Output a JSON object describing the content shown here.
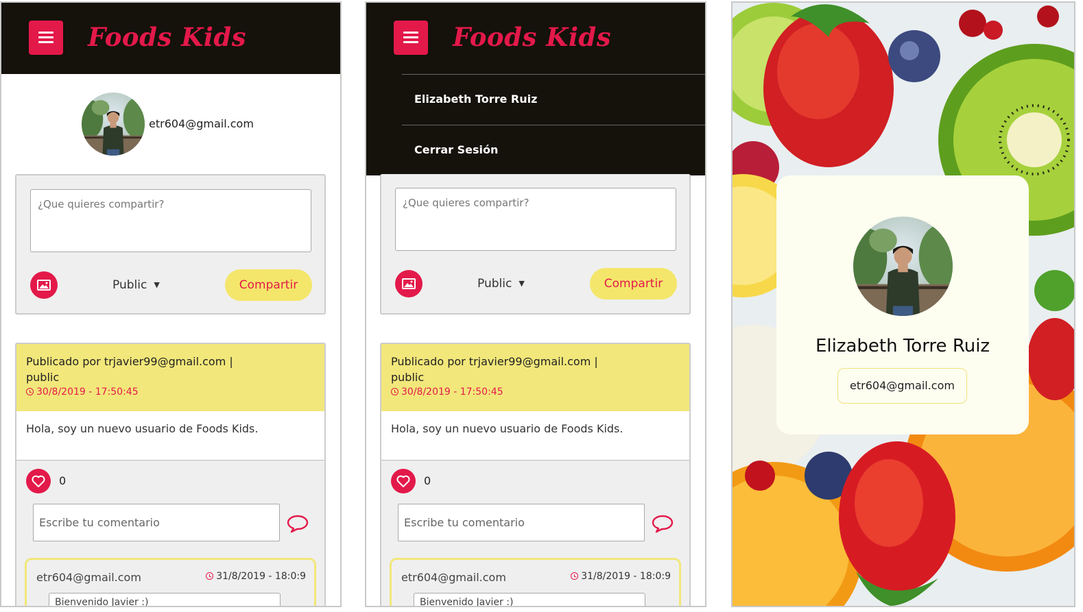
{
  "app": {
    "brand": "Foods Kids"
  },
  "user": {
    "email": "etr604@gmail.com",
    "name": "Elizabeth Torre Ruiz"
  },
  "menu": {
    "items": [
      {
        "label": "Elizabeth Torre Ruiz"
      },
      {
        "label": "Cerrar Sesión"
      }
    ]
  },
  "composer": {
    "placeholder": "¿Que quieres compartir?",
    "privacy": "Public",
    "share_label": "Compartir"
  },
  "post": {
    "author_line": "Publicado por trjavier99@gmail.com | public",
    "timestamp": "30/8/2019 - 17:50:45",
    "body": "Hola, soy un nuevo usuario de Foods Kids.",
    "likes": "0",
    "comment_placeholder": "Escribe tu comentario"
  },
  "comment": {
    "user": "etr604@gmail.com",
    "timestamp": "31/8/2019 - 18:0:9",
    "text": "Bienvenido Javier :)"
  },
  "colors": {
    "brand": "#e3194a",
    "header_bg": "#15110b",
    "accent_yellow": "#f4e66a"
  }
}
